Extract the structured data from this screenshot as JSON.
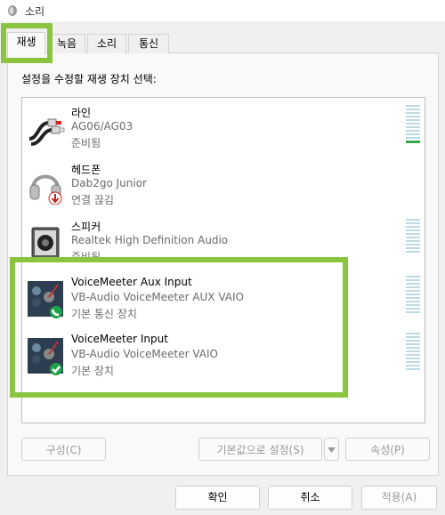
{
  "window": {
    "title": "소리"
  },
  "tabs": [
    {
      "label": "재생"
    },
    {
      "label": "녹음"
    },
    {
      "label": "소리"
    },
    {
      "label": "통신"
    }
  ],
  "prompt": "설정을 수정할 재생 장치 선택:",
  "devices": [
    {
      "name": "라인",
      "driver": "AG06/AG03",
      "status": "준비됨",
      "icon": "line-cable-icon",
      "badge": ""
    },
    {
      "name": "헤드폰",
      "driver": "Dab2go Junior",
      "status": "연결 끊김",
      "icon": "headphones-icon",
      "badge": "disconnected-arrow"
    },
    {
      "name": "스피커",
      "driver": "Realtek High Definition Audio",
      "status": "준비됨",
      "icon": "speaker-icon",
      "badge": ""
    },
    {
      "name": "VoiceMeeter Aux Input",
      "driver": "VB-Audio VoiceMeeter AUX VAIO",
      "status": "기본 통신 장치",
      "icon": "voicemeeter-icon",
      "badge": "phone"
    },
    {
      "name": "VoiceMeeter Input",
      "driver": "VB-Audio VoiceMeeter VAIO",
      "status": "기본 장치",
      "icon": "voicemeeter-icon",
      "badge": "check"
    }
  ],
  "buttons": {
    "configure": "구성(C)",
    "set_default": "기본값으로 설정(S)",
    "properties": "속성(P)",
    "ok": "확인",
    "cancel": "취소",
    "apply": "적용(A)"
  },
  "colors": {
    "highlight": "#8bc53f",
    "meter_segment": "#bcdbe2",
    "meter_active": "#3aa64a",
    "default_badge": "#1fa34a"
  }
}
